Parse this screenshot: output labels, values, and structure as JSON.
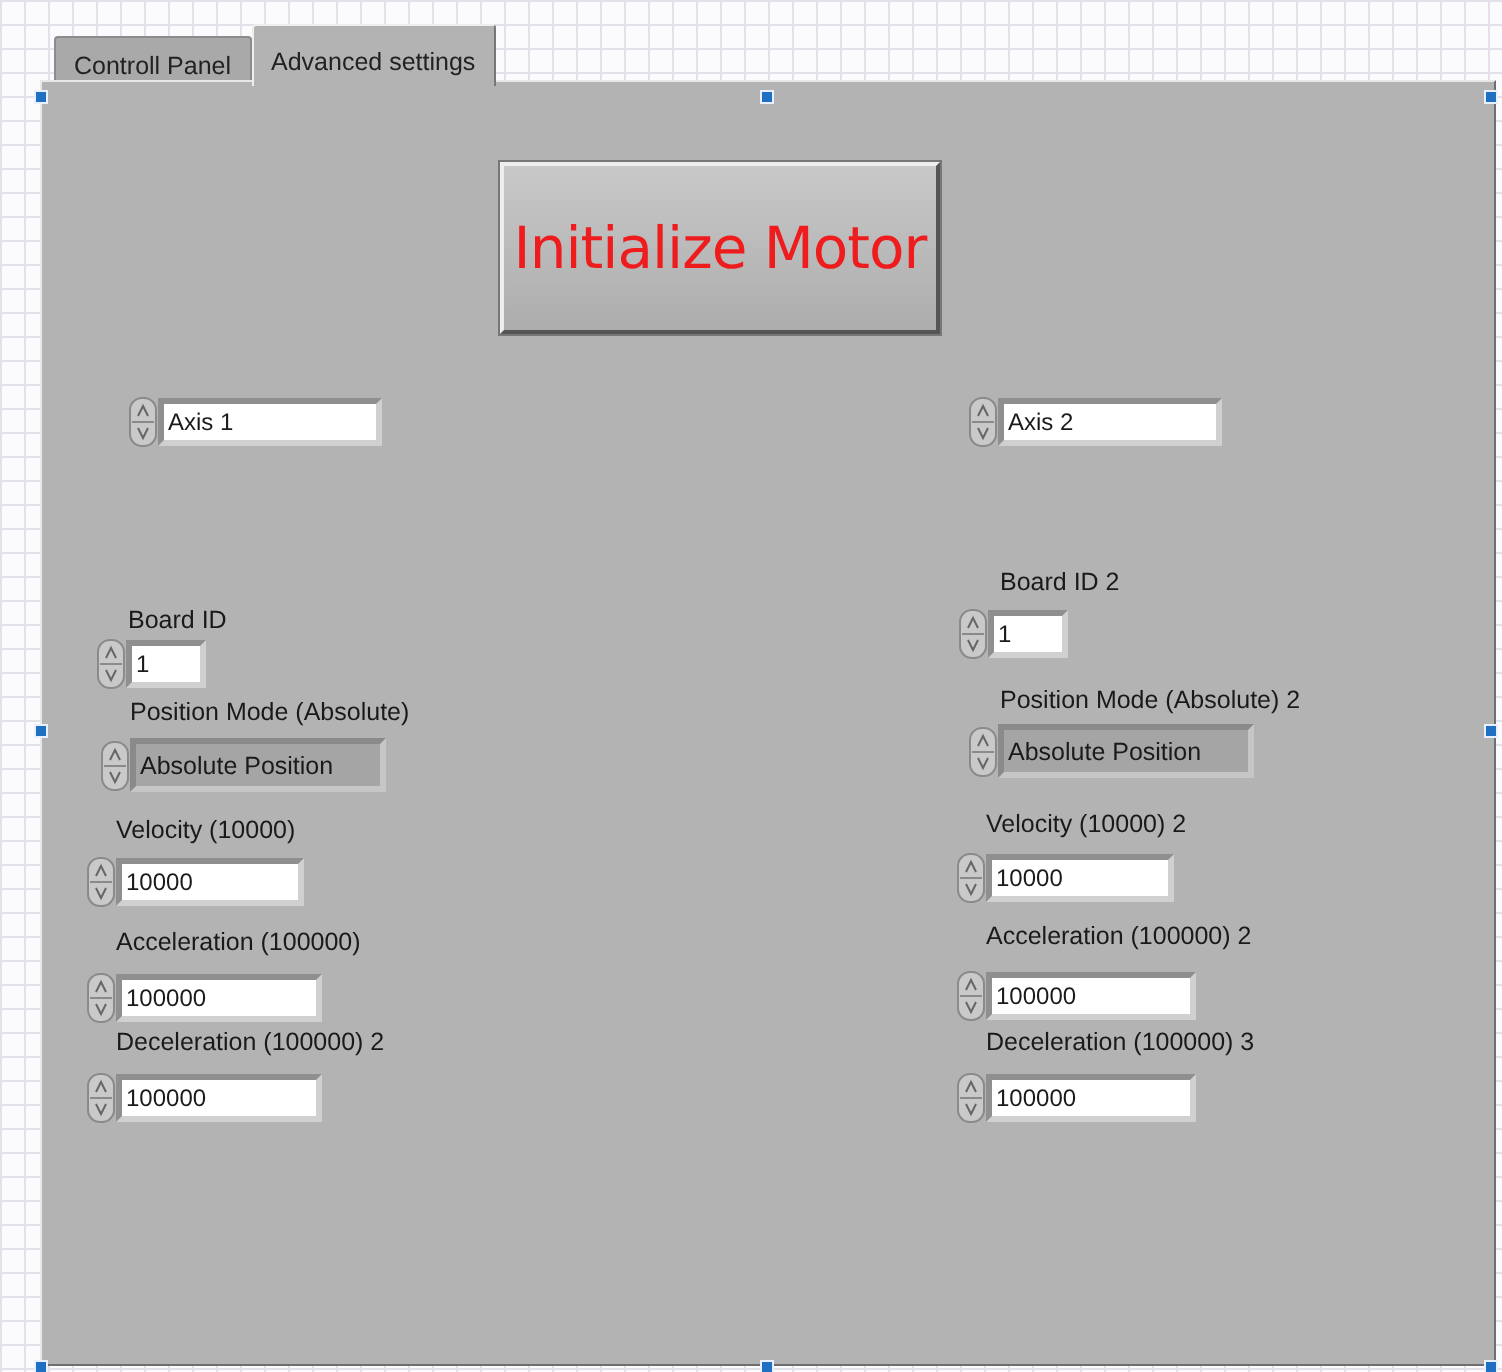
{
  "tabs": [
    {
      "label": "Controll Panel",
      "selected": false
    },
    {
      "label": "Advanced settings",
      "selected": true
    }
  ],
  "button": {
    "label": "Initialize Motor"
  },
  "columns": [
    {
      "axis": {
        "value": "Axis 1"
      },
      "controls": [
        {
          "kind": "numeric",
          "label": "Board ID",
          "value": "1"
        },
        {
          "kind": "ring",
          "label": "Position Mode (Absolute)",
          "value": "Absolute Position"
        },
        {
          "kind": "numeric",
          "label": "Velocity (10000)",
          "value": "10000"
        },
        {
          "kind": "numeric",
          "label": "Acceleration (100000)",
          "value": "100000"
        },
        {
          "kind": "numeric",
          "label": "Deceleration (100000) 2",
          "value": "100000"
        }
      ]
    },
    {
      "axis": {
        "value": "Axis 2"
      },
      "controls": [
        {
          "kind": "numeric",
          "label": "Board ID 2",
          "value": "1"
        },
        {
          "kind": "ring",
          "label": "Position Mode (Absolute) 2",
          "value": "Absolute Position"
        },
        {
          "kind": "numeric",
          "label": "Velocity (10000) 2",
          "value": "10000"
        },
        {
          "kind": "numeric",
          "label": "Acceleration (100000) 2",
          "value": "100000"
        },
        {
          "kind": "numeric",
          "label": "Deceleration (100000) 3",
          "value": "100000"
        }
      ]
    }
  ]
}
